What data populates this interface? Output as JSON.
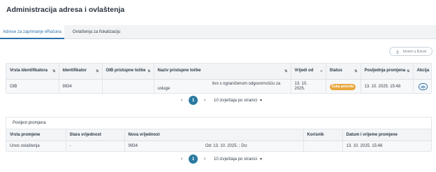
{
  "page": {
    "title": "Administracija adresa i ovlaštenja"
  },
  "tabs": [
    {
      "label": "Adrese za zaprimanje eRačuna"
    },
    {
      "label": "Ovlaštenja za fiskalizaciju"
    }
  ],
  "toolbar": {
    "export_label": "Izvezi u Excel"
  },
  "table1": {
    "columns": [
      "Vrsta identifikatora",
      "Identifikator",
      "OIB pristupne točke",
      "Naziv pristupne točke",
      "Vrijedi od",
      "Status",
      "Posljednja promjena",
      "Akcija"
    ],
    "row": {
      "vrsta": "OIB",
      "identifikator": "9934",
      "oib_pristupne": "",
      "naziv_line1": "itvo s ograničenom odgovornošću za",
      "naziv_line2": "usluge",
      "vrijedi_od_line1": "13. 10.",
      "vrijedi_od_line2": "2025.",
      "status": "Čeka potvrdu",
      "posljednja_promjena": "13. 10. 2025. 15:48"
    }
  },
  "pagination1": {
    "page": "1",
    "page_size_label": "10 izvještaja po stranici"
  },
  "history": {
    "title": "Povijest promjena",
    "columns": [
      "Vrsta promjene",
      "Stara vrijednost",
      "Nova vrijednost",
      "Korisnik",
      "Datum i vrijeme promjene"
    ],
    "row": {
      "vrsta_promjene": "Unos ovlaštenja",
      "stara_vrijednost": "-",
      "nova_vrijednost_prefix": "9934:",
      "nova_vrijednost_suffix": "Od: 13. 10. 2025. ; Do:",
      "korisnik": "",
      "datum": "13. 10. 2025. 15:48"
    }
  },
  "pagination2": {
    "page": "1",
    "page_size_label": "10 izvještaja po stranici"
  },
  "colors": {
    "accent": "#2a6fa8",
    "badge": "#e8a73b",
    "page_active": "#2a7aa0"
  }
}
